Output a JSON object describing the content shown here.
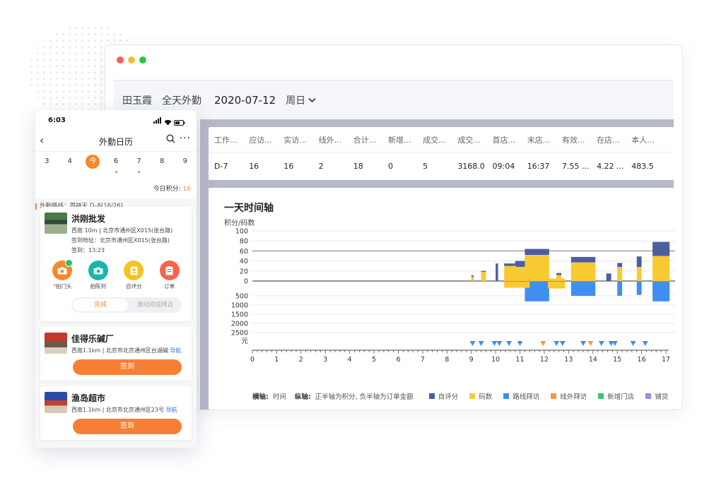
{
  "window": {
    "header": {
      "name": "田玉霞",
      "mode": "全天外勤",
      "date": "2020-07-12",
      "weekday": "周日"
    },
    "stats": {
      "headers": [
        "工作...",
        "应访...",
        "实访...",
        "线外...",
        "合计...",
        "新增...",
        "成交...",
        "成交...",
        "首店...",
        "末店...",
        "有效...",
        "在店...",
        "本人..."
      ],
      "values": [
        "D-7",
        "16",
        "16",
        "2",
        "18",
        "0",
        "5",
        "3168.0",
        "09:04",
        "16:37",
        "7.55 ...",
        "4.22 ...",
        "483.5"
      ]
    },
    "timeline": {
      "title": "一天时间轴",
      "unit": "积分/码数",
      "bottom_unit": "元",
      "legend_axis_label": "横轴:",
      "legend_axis_value": "时间",
      "legend_y_label": "纵轴:",
      "legend_y_value": "正半轴为积分, 负半轴为订单金额",
      "legend": [
        {
          "name": "自评分",
          "color": "#4b5ea0"
        },
        {
          "name": "码数",
          "color": "#f9c932"
        },
        {
          "name": "路线拜访",
          "color": "#3e8ff0"
        },
        {
          "name": "线外拜访",
          "color": "#f29a45"
        },
        {
          "name": "新增门店",
          "color": "#36c57a"
        },
        {
          "name": "铺货",
          "color": "#9b8ee8"
        }
      ]
    }
  },
  "chart_data": {
    "type": "bar",
    "title": "一天时间轴",
    "ylabel": "积分/码数",
    "xlabel": "",
    "x_range": [
      0,
      17
    ],
    "x_ticks": [
      0,
      1,
      2,
      3,
      4,
      5,
      6,
      7,
      8,
      9,
      10,
      11,
      12,
      13,
      14,
      15,
      16,
      17
    ],
    "y_top_ticks": [
      100,
      80,
      60,
      40,
      20,
      0
    ],
    "y_bottom_ticks": [
      500,
      1000,
      1500,
      2000,
      2500
    ],
    "y_top_lim": [
      0,
      100
    ],
    "y_bottom_lim": [
      0,
      2500
    ],
    "series_positive": [
      {
        "name": "自评分",
        "color": "#4b5ea0",
        "bars": [
          {
            "x": 9.0,
            "w": 0.1,
            "base": 8,
            "top": 11
          },
          {
            "x": 9.4,
            "w": 0.2,
            "base": 18,
            "top": 20
          },
          {
            "x": 10.0,
            "w": 0.1,
            "base": 0,
            "top": 35
          },
          {
            "x": 10.35,
            "w": 0.5,
            "base": 30,
            "top": 35
          },
          {
            "x": 10.8,
            "w": 0.6,
            "base": 28,
            "top": 40
          },
          {
            "x": 11.2,
            "w": 1.0,
            "base": 52,
            "top": 64
          },
          {
            "x": 12.5,
            "w": 0.2,
            "base": 12,
            "top": 16
          },
          {
            "x": 13.1,
            "w": 1.0,
            "base": 37,
            "top": 48
          },
          {
            "x": 14.0,
            "w": 0.05,
            "base": 0,
            "top": 5
          },
          {
            "x": 14.55,
            "w": 0.2,
            "base": 0,
            "top": 15
          },
          {
            "x": 15.0,
            "w": 0.2,
            "base": 28,
            "top": 36
          },
          {
            "x": 15.8,
            "w": 0.2,
            "base": 28,
            "top": 49
          },
          {
            "x": 16.45,
            "w": 0.7,
            "base": 50,
            "top": 78
          }
        ]
      },
      {
        "name": "码数",
        "color": "#f9c932",
        "bars": [
          {
            "x": 9.0,
            "w": 0.1,
            "base": 0,
            "top": 8
          },
          {
            "x": 9.4,
            "w": 0.2,
            "base": 0,
            "top": 18
          },
          {
            "x": 10.35,
            "w": 0.5,
            "base": 0,
            "top": 30
          },
          {
            "x": 10.8,
            "w": 0.6,
            "base": 0,
            "top": 28
          },
          {
            "x": 11.2,
            "w": 1.0,
            "base": 0,
            "top": 52
          },
          {
            "x": 12.15,
            "w": 0.7,
            "base": 0,
            "top": 5
          },
          {
            "x": 12.5,
            "w": 0.2,
            "base": 0,
            "top": 12
          },
          {
            "x": 13.1,
            "w": 1.0,
            "base": 0,
            "top": 37
          },
          {
            "x": 13.6,
            "w": 0.05,
            "base": 0,
            "top": 20
          },
          {
            "x": 15.0,
            "w": 0.2,
            "base": 0,
            "top": 28
          },
          {
            "x": 15.8,
            "w": 0.2,
            "base": 0,
            "top": 28
          },
          {
            "x": 16.45,
            "w": 0.7,
            "base": 0,
            "top": 50
          }
        ]
      }
    ],
    "series_negative": [
      {
        "name": "路线拜访",
        "color": "#3e8ff0",
        "bars": [
          {
            "x": 11.2,
            "w": 1.0,
            "value": 800
          },
          {
            "x": 13.1,
            "w": 1.0,
            "value": 500
          },
          {
            "x": 15.0,
            "w": 0.2,
            "value": 500
          },
          {
            "x": 15.8,
            "w": 0.2,
            "value": 450
          },
          {
            "x": 16.45,
            "w": 0.7,
            "value": 800
          }
        ]
      },
      {
        "name": "码数",
        "color": "#f9c932",
        "bars": [
          {
            "x": 10.35,
            "w": 0.5,
            "value": 60
          },
          {
            "x": 10.8,
            "w": 0.6,
            "value": 60
          },
          {
            "x": 12.15,
            "w": 0.7,
            "value": 100
          },
          {
            "x": 12.5,
            "w": 0.2,
            "value": 60
          }
        ]
      }
    ],
    "markers": [
      {
        "x": 9.05,
        "type": "路线拜访"
      },
      {
        "x": 9.4,
        "type": "路线拜访"
      },
      {
        "x": 9.95,
        "type": "路线拜访"
      },
      {
        "x": 10.15,
        "type": "路线拜访"
      },
      {
        "x": 10.55,
        "type": "路线拜访"
      },
      {
        "x": 11.0,
        "type": "路线拜访"
      },
      {
        "x": 11.95,
        "type": "线外拜访"
      },
      {
        "x": 12.5,
        "type": "路线拜访"
      },
      {
        "x": 12.75,
        "type": "路线拜访"
      },
      {
        "x": 13.6,
        "type": "路线拜访"
      },
      {
        "x": 13.9,
        "type": "线外拜访"
      },
      {
        "x": 14.35,
        "type": "路线拜访"
      },
      {
        "x": 14.75,
        "type": "路线拜访"
      },
      {
        "x": 14.9,
        "type": "路线拜访"
      },
      {
        "x": 15.65,
        "type": "路线拜访"
      },
      {
        "x": 16.15,
        "type": "路线拜访"
      }
    ]
  },
  "phone": {
    "time": "6:03",
    "nav_title": "外勤日历",
    "dates": [
      {
        "label": "3",
        "today": false,
        "dot": false
      },
      {
        "label": "4",
        "today": false,
        "dot": false
      },
      {
        "label": "今",
        "today": true,
        "dot": false
      },
      {
        "label": "6",
        "today": false,
        "dot": true
      },
      {
        "label": "7",
        "today": false,
        "dot": true
      },
      {
        "label": "8",
        "today": false,
        "dot": false
      },
      {
        "label": "9",
        "today": false,
        "dot": false
      }
    ],
    "score_label": "今日积分:",
    "score_value": "16",
    "route": "外勤路线：周晓天 D–8(16/26)",
    "store1": {
      "name": "洪刚批发",
      "line1": "西南 10m | 北京市通州区X015(张台路)",
      "line2": "签到地址：北京市通州区X015(张台路)",
      "line3": "签到：13:23",
      "actions": [
        {
          "label": "拍门头",
          "required": "*",
          "color": "#f5882a"
        },
        {
          "label": "拍陈列",
          "required": "",
          "color": "#17b5ae"
        },
        {
          "label": "自评分",
          "required": "",
          "color": "#f5c21f"
        },
        {
          "label": "订单",
          "required": "",
          "color": "#f4654f"
        }
      ],
      "toggle_on": "完成",
      "toggle_off": "滑动完成拜访"
    },
    "store2": {
      "name": "佳得乐碱厂",
      "line1": "西南1.1km | 北京市北京通州区台湖碱",
      "nav": "导航",
      "button": "签到"
    },
    "store3": {
      "name": "渔岛超市",
      "line1": "西南1.1km | 北京市北京通州区23号",
      "nav": "导航",
      "button": "签到"
    }
  }
}
